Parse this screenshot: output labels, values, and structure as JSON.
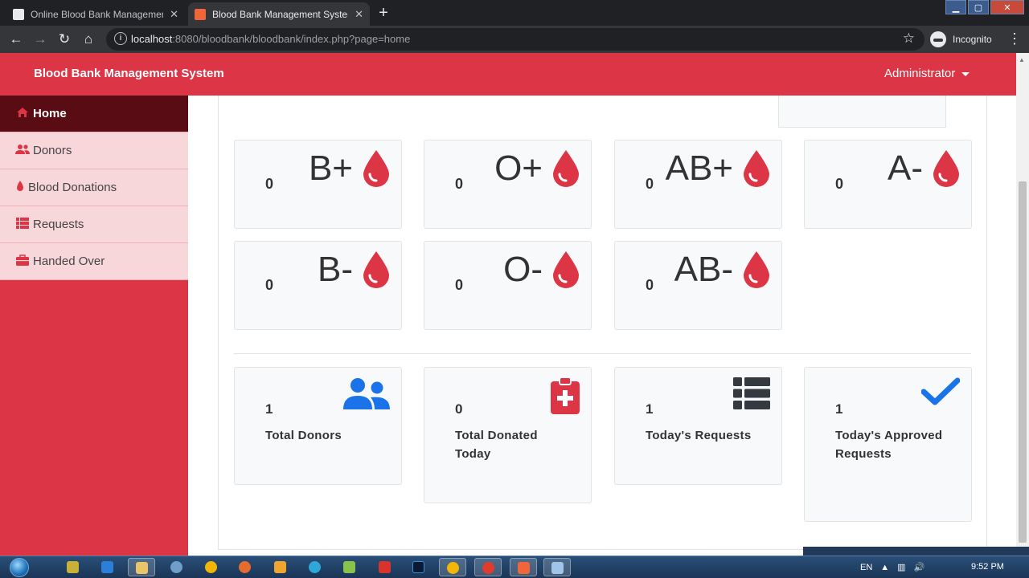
{
  "browser": {
    "tabs": [
      {
        "title": "Online Blood Bank Management",
        "active": false
      },
      {
        "title": "Blood Bank Management System",
        "active": true
      }
    ],
    "url_host": "localhost",
    "url_rest": ":8080/bloodbank/bloodbank/index.php?page=home",
    "profile_label": "Incognito"
  },
  "app": {
    "brand": "Blood Bank Management System",
    "user_menu": "Administrator",
    "accent_color": "#dc3545"
  },
  "sidebar": {
    "items": [
      {
        "label": "Home",
        "icon": "home-icon",
        "active": true
      },
      {
        "label": "Donors",
        "icon": "users-icon",
        "active": false
      },
      {
        "label": "Blood Donations",
        "icon": "tint-icon",
        "active": false
      },
      {
        "label": "Requests",
        "icon": "list-icon",
        "active": false
      },
      {
        "label": "Handed Over",
        "icon": "toolbox-icon",
        "active": false
      }
    ]
  },
  "blood_groups": [
    {
      "group": "B+",
      "count": "0"
    },
    {
      "group": "O+",
      "count": "0"
    },
    {
      "group": "AB+",
      "count": "0"
    },
    {
      "group": "A-",
      "count": "0"
    },
    {
      "group": "B-",
      "count": "0"
    },
    {
      "group": "O-",
      "count": "0"
    },
    {
      "group": "AB-",
      "count": "0"
    }
  ],
  "stats": [
    {
      "value": "1",
      "label": "Total Donors",
      "icon": "users-icon",
      "icon_color": "#1a73e8"
    },
    {
      "value": "0",
      "label": "Total Donated Today",
      "icon": "clipboard-plus-icon",
      "icon_color": "#dc3545"
    },
    {
      "value": "1",
      "label": "Today's Requests",
      "icon": "list-icon",
      "icon_color": "#343a40"
    },
    {
      "value": "1",
      "label": "Today's Approved Requests",
      "icon": "check-icon",
      "icon_color": "#1a73e8"
    }
  ],
  "taskbar": {
    "language": "EN",
    "time": "9:52 PM"
  }
}
